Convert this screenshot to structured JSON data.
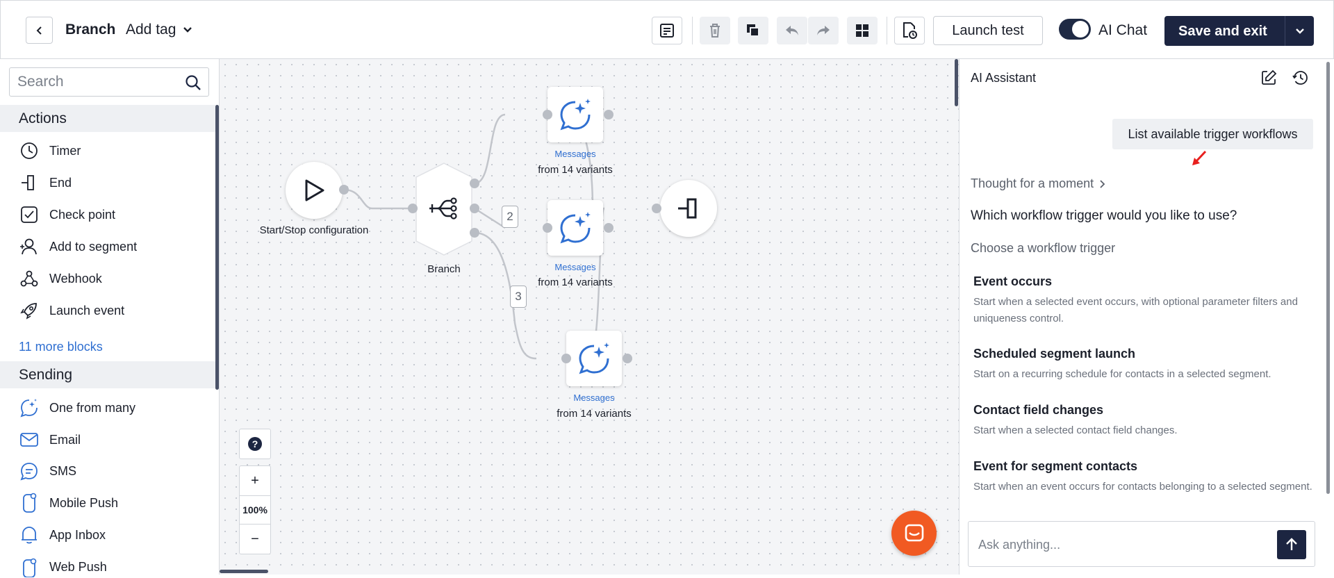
{
  "header": {
    "title": "Branch",
    "add_tag_label": "Add tag",
    "launch_test_label": "Launch test",
    "ai_chat_label": "AI Chat",
    "save_label": "Save and exit",
    "ai_chat_enabled": true
  },
  "sidebar": {
    "search_placeholder": "Search",
    "actions_heading": "Actions",
    "actions": [
      {
        "label": "Timer",
        "icon": "timer-icon"
      },
      {
        "label": "End",
        "icon": "end-icon"
      },
      {
        "label": "Check point",
        "icon": "check-point-icon"
      },
      {
        "label": "Add to segment",
        "icon": "add-to-segment-icon"
      },
      {
        "label": "Webhook",
        "icon": "webhook-icon"
      },
      {
        "label": "Launch event",
        "icon": "launch-event-icon"
      }
    ],
    "more_blocks_label": "11 more blocks",
    "sending_heading": "Sending",
    "sending": [
      {
        "label": "One from many",
        "icon": "one-from-many-icon"
      },
      {
        "label": "Email",
        "icon": "email-icon"
      },
      {
        "label": "SMS",
        "icon": "sms-icon"
      },
      {
        "label": "Mobile Push",
        "icon": "mobile-push-icon"
      },
      {
        "label": "App Inbox",
        "icon": "app-inbox-icon"
      },
      {
        "label": "Web Push",
        "icon": "web-push-icon"
      }
    ]
  },
  "canvas": {
    "start_label": "Start/Stop configuration",
    "branch_label": "Branch",
    "messages": [
      {
        "title": "Messages",
        "sub": "from 14 variants"
      },
      {
        "title": "Messages",
        "sub": "from 14 variants"
      },
      {
        "title": "Messages",
        "sub": "from 14 variants"
      }
    ],
    "badge_2": "2",
    "badge_3": "3",
    "help_label": "?",
    "zoom_in": "+",
    "zoom_level": "100%",
    "zoom_out": "−"
  },
  "ai_panel": {
    "title": "AI Assistant",
    "user_message": "List available trigger workflows",
    "thought_label": "Thought for a moment",
    "question": "Which workflow trigger would you like to use?",
    "choose_label": "Choose a workflow trigger",
    "triggers": [
      {
        "title": "Event occurs",
        "desc": "Start when a selected event occurs, with optional parameter filters and uniqueness control."
      },
      {
        "title": "Scheduled segment launch",
        "desc": "Start on a recurring schedule for contacts in a selected segment."
      },
      {
        "title": "Contact field changes",
        "desc": "Start when a selected contact field changes."
      },
      {
        "title": "Event for segment contacts",
        "desc": "Start when an event occurs for contacts belonging to a selected segment."
      }
    ],
    "input_placeholder": "Ask anything..."
  },
  "colors": {
    "primary_dark": "#1c2541",
    "link_blue": "#2f6fd1",
    "chat_orange": "#f15a22",
    "canvas_bg": "#f4f5f7"
  }
}
